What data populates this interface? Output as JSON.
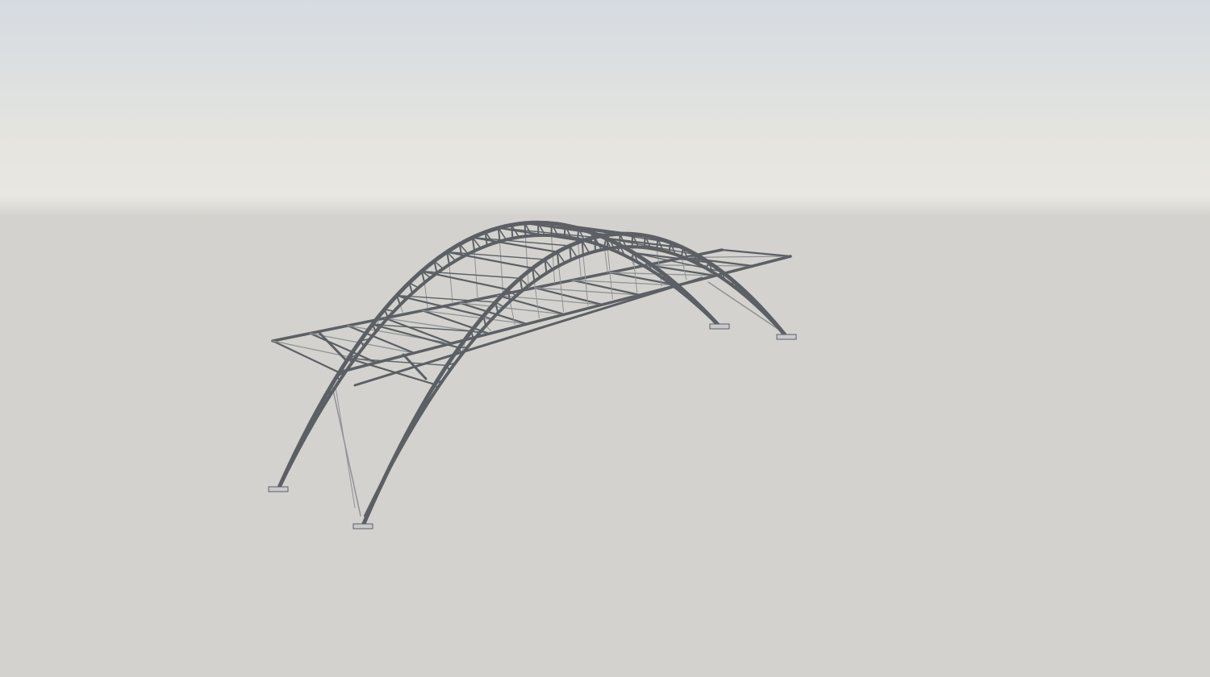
{
  "scene": {
    "subject": "steel-truss-arch-bridge",
    "colors": {
      "sky_top": "#d5dbe1",
      "sky_mid": "#e6e5df",
      "horizon": "#e8e7e1",
      "ground": "#d3d2ce",
      "steel": "#5c6064",
      "steel_light": "#8f9396",
      "base_plate": "#c9cacc"
    }
  }
}
